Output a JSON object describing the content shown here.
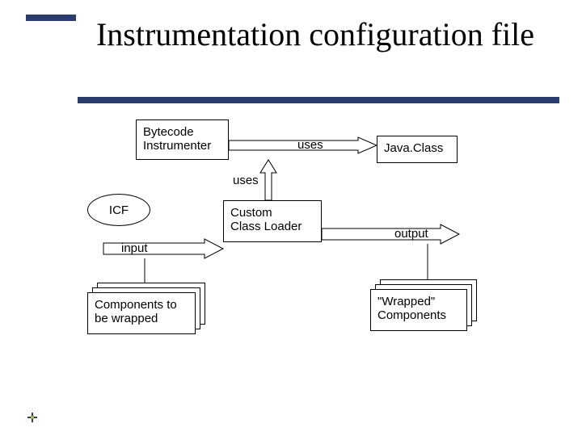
{
  "title": "Instrumentation configuration file",
  "diagram": {
    "bytecode": "Bytecode\nInstrumenter",
    "javaclass": "Java.Class",
    "icf": "ICF",
    "loader": "Custom\nClass Loader",
    "components_in": "Components to\nbe wrapped",
    "components_out": "\"Wrapped\"\nComponents",
    "label_uses_top": "uses",
    "label_uses_mid": "uses",
    "label_input": "input",
    "label_output": "output"
  }
}
